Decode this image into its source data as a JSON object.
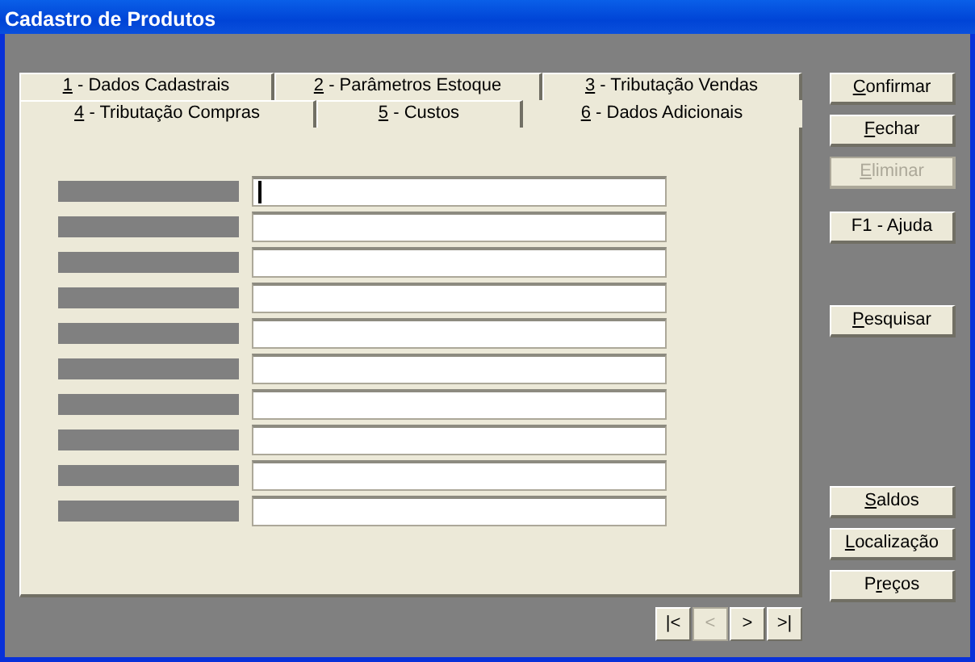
{
  "window": {
    "title": "Cadastro de Produtos"
  },
  "tabs": [
    [
      {
        "mnemonic": "1",
        "label": " - Dados Cadastrais",
        "selected": false
      },
      {
        "mnemonic": "2",
        "label": " - Parâmetros Estoque",
        "selected": false
      },
      {
        "mnemonic": "3",
        "label": " - Tributação Vendas",
        "selected": false
      }
    ],
    [
      {
        "mnemonic": "4",
        "label": " - Tributação Compras",
        "selected": false
      },
      {
        "mnemonic": "5",
        "label": " - Custos",
        "selected": false
      },
      {
        "mnemonic": "6",
        "label": " - Dados Adicionais",
        "selected": true
      }
    ]
  ],
  "fields": [
    {
      "focused": true
    },
    {
      "focused": false
    },
    {
      "focused": false
    },
    {
      "focused": false
    },
    {
      "focused": false
    },
    {
      "focused": false
    },
    {
      "focused": false
    },
    {
      "focused": false
    },
    {
      "focused": false
    },
    {
      "focused": false
    }
  ],
  "button_groups": [
    [
      {
        "mnemonic": "C",
        "label_after": "onfirmar",
        "disabled": false
      },
      {
        "mnemonic": "F",
        "label_after": "echar",
        "disabled": false
      },
      {
        "mnemonic": "E",
        "label_after": "liminar",
        "disabled": true
      }
    ],
    [
      {
        "label_after": "F1 - Ajuda",
        "disabled": false
      }
    ],
    [
      {
        "mnemonic": "P",
        "label_after": "esquisar",
        "disabled": false
      }
    ],
    [
      {
        "mnemonic": "S",
        "label_after": "aldos",
        "disabled": false
      },
      {
        "mnemonic": "L",
        "label_after": "ocalização",
        "disabled": false
      },
      {
        "label_before": "P",
        "mnemonic": "r",
        "label_after": "eços",
        "disabled": false
      }
    ]
  ],
  "navigation": [
    {
      "label": "|<",
      "disabled": false
    },
    {
      "label": "<",
      "disabled": true
    },
    {
      "label": ">",
      "disabled": false
    },
    {
      "label": ">|",
      "disabled": false
    }
  ]
}
